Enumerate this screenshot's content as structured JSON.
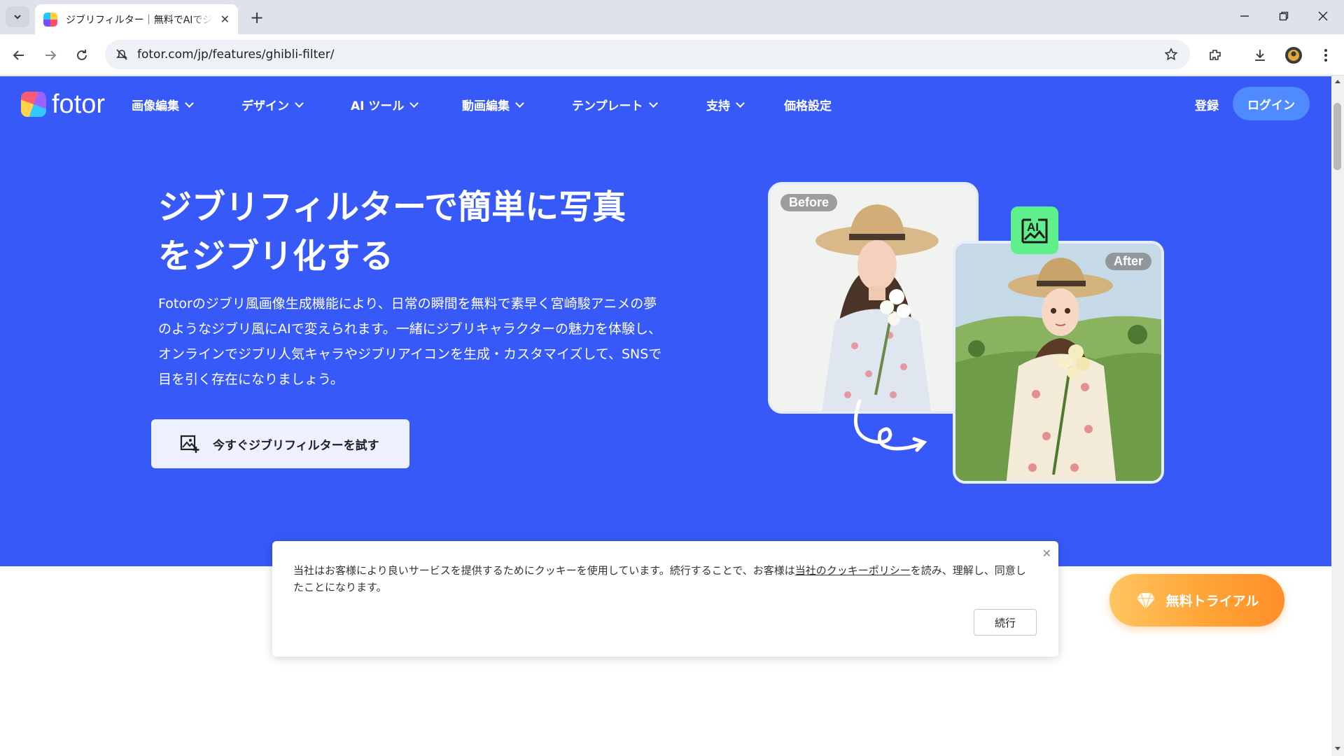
{
  "browser": {
    "tab_title": "ジブリフィルター｜無料でAIでジブリ",
    "url": "fotor.com/jp/features/ghibli-filter/"
  },
  "nav": {
    "logo_text": "fotor",
    "menu": [
      "画像編集",
      "デザイン",
      "AI ツール",
      "動画編集",
      "テンプレート",
      "支持",
      "価格設定"
    ],
    "register": "登録",
    "login": "ログイン"
  },
  "hero": {
    "title_line1": "ジブリフィルターで簡単に写真",
    "title_line2": "をジブリ化する",
    "description": "Fotorのジブリ風画像生成機能により、日常の瞬間を無料で素早く宮崎駿アニメの夢のようなジブリ風にAIで変えられます。一緒にジブリキャラクターの魅力を体験し、オンラインでジブリ人気キャラやジブリアイコンを生成・カスタマイズして、SNSで目を引く存在になりましょう。",
    "cta": "今すぐジブリフィルターを試す",
    "before_label": "Before",
    "after_label": "After"
  },
  "cookie": {
    "text_before": "当社はお客様により良いサービスを提供するためにクッキーを使用しています。続行することで、お客様は",
    "link_text": "当社のクッキーポリシー",
    "text_after": "を読み、理解し、同意したことになります。",
    "continue": "続行"
  },
  "trial": {
    "label": "無料トライアル"
  },
  "colors": {
    "hero_bg": "#3759f7",
    "login_bg": "#4f8aff",
    "ai_badge": "#5ff08c",
    "trial_start": "#ffc560",
    "trial_end": "#ff8e2a"
  }
}
